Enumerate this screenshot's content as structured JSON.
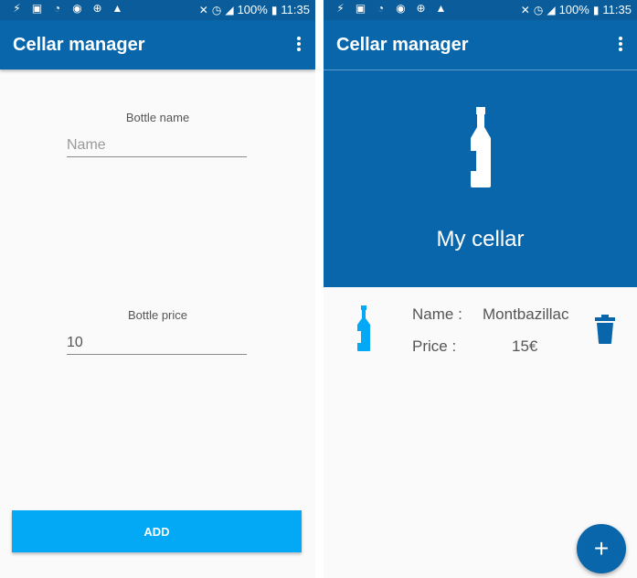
{
  "status_bar": {
    "battery": "100%",
    "time": "11:35"
  },
  "left_screen": {
    "app_title": "Cellar manager",
    "bottle_name_label": "Bottle name",
    "bottle_name_placeholder": "Name",
    "bottle_price_label": "Bottle price",
    "bottle_price_value": "10",
    "add_button": "ADD"
  },
  "right_screen": {
    "app_title": "Cellar manager",
    "header_title": "My cellar",
    "list": [
      {
        "name_label": "Name :",
        "name_value": "Montbazillac",
        "price_label": "Price :",
        "price_value": "15€"
      }
    ],
    "fab_label": "+"
  },
  "colors": {
    "primary": "#0a66aa",
    "status_bar": "#0a5d9a",
    "accent": "#03a9f4"
  }
}
